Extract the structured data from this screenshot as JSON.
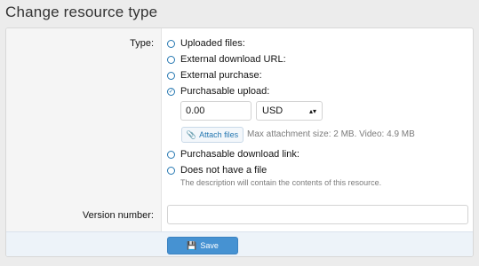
{
  "title": "Change resource type",
  "form": {
    "type_label": "Type:",
    "options": [
      {
        "label": "Uploaded files:",
        "selected": false
      },
      {
        "label": "External download URL:",
        "selected": false
      },
      {
        "label": "External purchase:",
        "selected": false
      },
      {
        "label": "Purchasable upload:",
        "selected": true
      },
      {
        "label": "Purchasable download link:",
        "selected": false
      },
      {
        "label": "Does not have a file",
        "selected": false
      }
    ],
    "price_value": "0.00",
    "currency": "USD",
    "attach_label": "Attach files",
    "attach_note": "Max attachment size: 2 MB. Video: 4.9 MB",
    "no_file_hint": "The description will contain the contents of this resource.",
    "version_label": "Version number:",
    "version_value": ""
  },
  "footer": {
    "save_label": "Save"
  },
  "icons": {
    "radio_checked": "check-icon",
    "attach": "paperclip-icon",
    "save": "save-icon",
    "select": "updown-arrows-icon"
  },
  "colors": {
    "accent": "#2577b1",
    "button": "#4692d2"
  }
}
